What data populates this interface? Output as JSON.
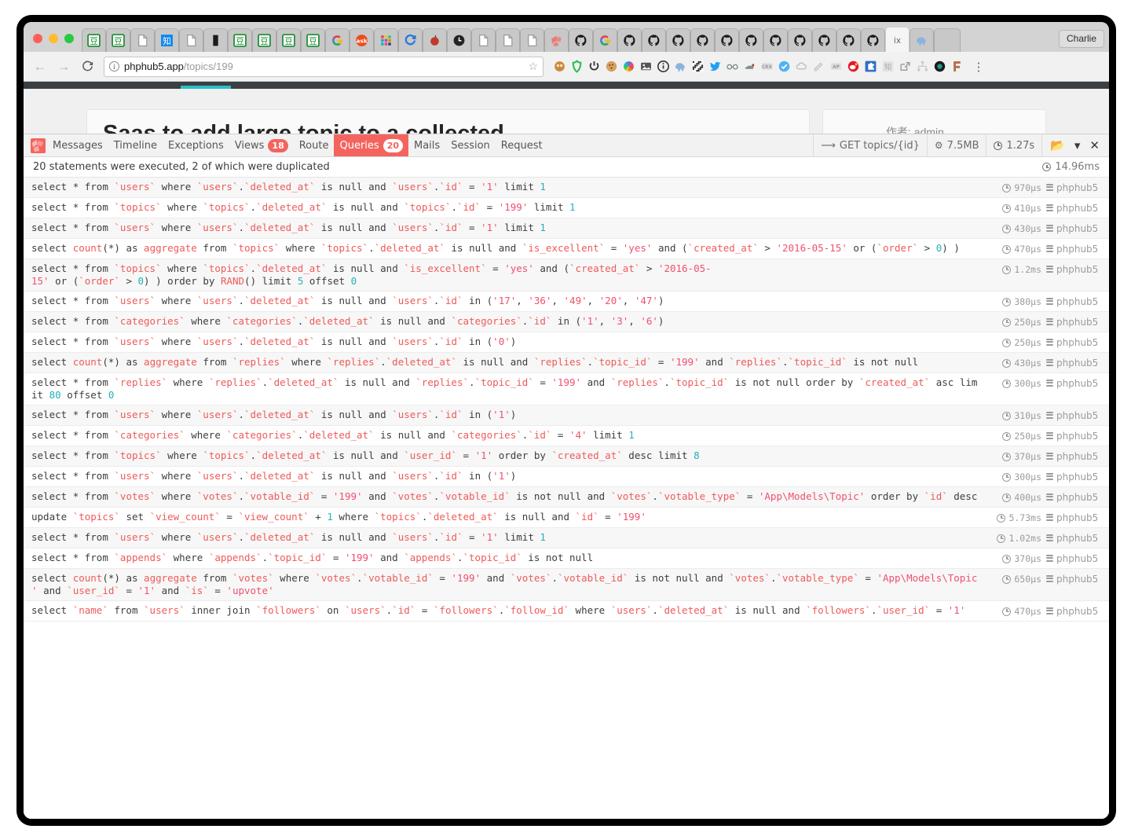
{
  "browser": {
    "profile_label": "Charlie",
    "url_host": "phphub5.app",
    "url_path": "/topics/199",
    "back_icon": "back-arrow-icon",
    "forward_icon": "forward-arrow-icon",
    "reload_icon": "reload-icon",
    "info_icon": "site-info-icon",
    "star_icon": "bookmark-star-icon",
    "menu_icon": "chrome-menu-icon",
    "tabs": [
      {
        "icon": "green-doc-icon"
      },
      {
        "icon": "green-doc-icon"
      },
      {
        "icon": "blank-page-icon"
      },
      {
        "icon": "zhihu-icon"
      },
      {
        "icon": "blank-page-icon"
      },
      {
        "icon": "black-book-icon"
      },
      {
        "icon": "green-doc-icon"
      },
      {
        "icon": "green-doc-icon"
      },
      {
        "icon": "green-doc-icon"
      },
      {
        "icon": "green-doc-icon"
      },
      {
        "icon": "google-icon"
      },
      {
        "icon": "ask-icon"
      },
      {
        "icon": "grid-apps-icon"
      },
      {
        "icon": "refresh-blue-icon"
      },
      {
        "icon": "red-dot-icon"
      },
      {
        "icon": "clock-black-icon"
      },
      {
        "icon": "blank-page-icon"
      },
      {
        "icon": "blank-page-icon"
      },
      {
        "icon": "blank-page-icon"
      },
      {
        "icon": "laravel-icon"
      },
      {
        "icon": "github-icon"
      },
      {
        "icon": "google-icon"
      },
      {
        "icon": "github-icon"
      },
      {
        "icon": "github-icon"
      },
      {
        "icon": "github-icon"
      },
      {
        "icon": "github-icon"
      },
      {
        "icon": "github-icon"
      },
      {
        "icon": "github-icon"
      },
      {
        "icon": "github-icon"
      },
      {
        "icon": "github-icon"
      },
      {
        "icon": "github-icon"
      },
      {
        "icon": "github-icon"
      },
      {
        "icon": "github-icon"
      },
      {
        "icon": "ix-icon"
      },
      {
        "icon": "elephant-icon"
      }
    ],
    "extensions": [
      "monkey-icon",
      "shield-green-icon",
      "power-icon",
      "cookie-icon",
      "color-wheel-icon",
      "image-icon",
      "info-circle-icon",
      "elephant-icon",
      "qrcode-icon",
      "twitter-icon",
      "glasses-icon",
      "bird-icon",
      "crx-icon",
      "check-badge-icon",
      "cloud-icon",
      "paint-icon",
      "ap-icon",
      "weibo-icon",
      "puzzle-icon",
      "zhi-icon",
      "external-link-icon",
      "sitemap-icon",
      "eye-dark-icon",
      "f-icon"
    ]
  },
  "page": {
    "heading": "Saas to add large topic to a collected",
    "author_label": "作者: admin"
  },
  "debugbar": {
    "logo": "laravel-logo-icon",
    "tabs": [
      {
        "label": "Messages",
        "badge": null,
        "active": false
      },
      {
        "label": "Timeline",
        "badge": null,
        "active": false
      },
      {
        "label": "Exceptions",
        "badge": null,
        "active": false
      },
      {
        "label": "Views",
        "badge": "18",
        "active": false
      },
      {
        "label": "Route",
        "badge": null,
        "active": false
      },
      {
        "label": "Queries",
        "badge": "20",
        "active": true
      },
      {
        "label": "Mails",
        "badge": null,
        "active": false
      },
      {
        "label": "Session",
        "badge": null,
        "active": false
      },
      {
        "label": "Request",
        "badge": null,
        "active": false
      }
    ],
    "meta": {
      "route": "GET topics/{id}",
      "route_icon": "arrow-curve-icon",
      "memory": "7.5MB",
      "memory_icon": "gears-icon",
      "time": "1.27s",
      "time_icon": "clock-icon"
    },
    "controls": [
      {
        "icon": "folder-icon"
      },
      {
        "icon": "chevron-down-icon"
      },
      {
        "icon": "close-x-icon"
      }
    ],
    "summary": "20 statements were executed, 2 of which were duplicated",
    "total_time": "14.96ms",
    "accent_color": "#f4645f",
    "badge_color": "#f4645f",
    "connection": "phphub5",
    "queries": [
      {
        "sql": "select * from `users` where `users`.`deleted_at` is null and `users`.`id` = '1' limit 1",
        "time": "970µs",
        "connection": "phphub5"
      },
      {
        "sql": "select * from `topics` where `topics`.`deleted_at` is null and `topics`.`id` = '199' limit 1",
        "time": "410µs",
        "connection": "phphub5"
      },
      {
        "sql": "select * from `users` where `users`.`deleted_at` is null and `users`.`id` = '1' limit 1",
        "time": "430µs",
        "connection": "phphub5"
      },
      {
        "sql": "select count(*) as aggregate from `topics` where `topics`.`deleted_at` is null and `is_excellent` = 'yes' and (`created_at` > '2016-05-15' or (`order` > 0) )",
        "time": "470µs",
        "connection": "phphub5"
      },
      {
        "sql": "select * from `topics` where `topics`.`deleted_at` is null and `is_excellent` = 'yes' and (`created_at` > '2016-05-15' or (`order` > 0) ) order by RAND() limit 5 offset 0",
        "time": "1.2ms",
        "connection": "phphub5"
      },
      {
        "sql": "select * from `users` where `users`.`deleted_at` is null and `users`.`id` in ('17', '36', '49', '20', '47')",
        "time": "380µs",
        "connection": "phphub5"
      },
      {
        "sql": "select * from `categories` where `categories`.`deleted_at` is null and `categories`.`id` in ('1', '3', '6')",
        "time": "250µs",
        "connection": "phphub5"
      },
      {
        "sql": "select * from `users` where `users`.`deleted_at` is null and `users`.`id` in ('0')",
        "time": "250µs",
        "connection": "phphub5"
      },
      {
        "sql": "select count(*) as aggregate from `replies` where `replies`.`deleted_at` is null and `replies`.`topic_id` = '199' and `replies`.`topic_id` is not null",
        "time": "430µs",
        "connection": "phphub5"
      },
      {
        "sql": "select * from `replies` where `replies`.`deleted_at` is null and `replies`.`topic_id` = '199' and `replies`.`topic_id` is not null order by `created_at` asc limit 80 offset 0",
        "time": "300µs",
        "connection": "phphub5"
      },
      {
        "sql": "select * from `users` where `users`.`deleted_at` is null and `users`.`id` in ('1')",
        "time": "310µs",
        "connection": "phphub5"
      },
      {
        "sql": "select * from `categories` where `categories`.`deleted_at` is null and `categories`.`id` = '4' limit 1",
        "time": "250µs",
        "connection": "phphub5"
      },
      {
        "sql": "select * from `topics` where `topics`.`deleted_at` is null and `user_id` = '1' order by `created_at` desc limit 8",
        "time": "370µs",
        "connection": "phphub5"
      },
      {
        "sql": "select * from `users` where `users`.`deleted_at` is null and `users`.`id` in ('1')",
        "time": "300µs",
        "connection": "phphub5"
      },
      {
        "sql": "select * from `votes` where `votes`.`votable_id` = '199' and `votes`.`votable_id` is not null and `votes`.`votable_type` = 'App\\Models\\Topic' order by `id` desc",
        "time": "400µs",
        "connection": "phphub5"
      },
      {
        "sql": "update `topics` set `view_count` = `view_count` + 1 where `topics`.`deleted_at` is null and `id` = '199'",
        "time": "5.73ms",
        "connection": "phphub5"
      },
      {
        "sql": "select * from `users` where `users`.`deleted_at` is null and `users`.`id` = '1' limit 1",
        "time": "1.02ms",
        "connection": "phphub5"
      },
      {
        "sql": "select * from `appends` where `appends`.`topic_id` = '199' and `appends`.`topic_id` is not null",
        "time": "370µs",
        "connection": "phphub5"
      },
      {
        "sql": "select count(*) as aggregate from `votes` where `votes`.`votable_id` = '199' and `votes`.`votable_id` is not null and `votes`.`votable_type` = 'App\\Models\\Topic' and `user_id` = '1' and `is` = 'upvote'",
        "time": "650µs",
        "connection": "phphub5"
      },
      {
        "sql": "select `name` from `users` inner join `followers` on `users`.`id` = `followers`.`follow_id` where `users`.`deleted_at` is null and `followers`.`user_id` = '1'",
        "time": "470µs",
        "connection": "phphub5"
      }
    ]
  }
}
